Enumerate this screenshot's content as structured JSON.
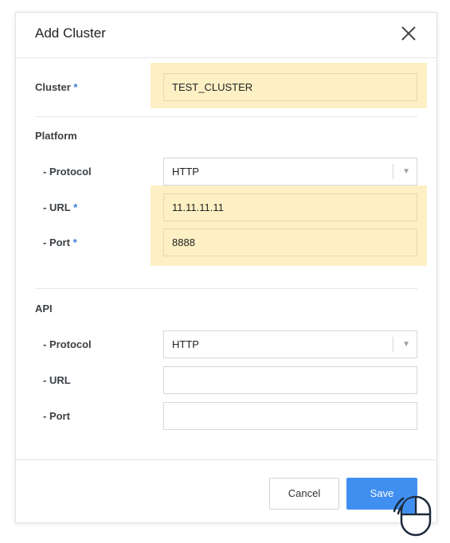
{
  "dialog": {
    "title": "Add Cluster"
  },
  "cluster": {
    "label": "Cluster",
    "required_mark": "*",
    "value": "TEST_CLUSTER"
  },
  "platform": {
    "section_title": "Platform",
    "protocol": {
      "label": "- Protocol",
      "value": "HTTP"
    },
    "url": {
      "label": "- URL",
      "required_mark": "*",
      "value": "11.11.11.11"
    },
    "port": {
      "label": "- Port",
      "required_mark": "*",
      "value": "8888"
    }
  },
  "api": {
    "section_title": "API",
    "protocol": {
      "label": "- Protocol",
      "value": "HTTP"
    },
    "url": {
      "label": "- URL",
      "value": ""
    },
    "port": {
      "label": "- Port",
      "value": ""
    }
  },
  "footer": {
    "cancel_label": "Cancel",
    "save_label": "Save"
  },
  "colors": {
    "accent": "#3f8ef0",
    "highlight": "#fdf0c4",
    "required": "#3a7bd5"
  },
  "icons": {
    "close": "close-icon",
    "select_arrow": "dropdown-arrow-icon",
    "mouse": "mouse-click-icon"
  }
}
